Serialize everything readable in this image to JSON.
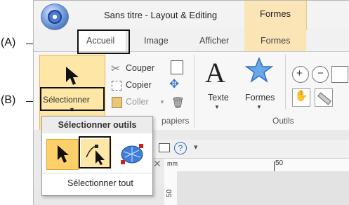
{
  "callouts": {
    "a": "(A)",
    "b": "(B)"
  },
  "window": {
    "title": "Sans titre - Layout & Editing",
    "context_tab": "Formes"
  },
  "tabs": [
    "Accueil",
    "Image",
    "Afficher",
    "Formes"
  ],
  "ribbon": {
    "select_button": "Sélectionner",
    "cut": "Couper",
    "copy": "Copier",
    "paste": "Coller",
    "clipboard_group_partial": "papiers",
    "text_button": "Texte",
    "shapes_button": "Formes",
    "tools_group": "Outils"
  },
  "dropdown": {
    "header": "Sélectionner outils",
    "select_all": "Sélectionner tout",
    "tools": [
      "select-arrow-icon",
      "select-point-icon",
      "select-lasso-icon"
    ]
  },
  "ruler": {
    "mark_50": "50",
    "unit": "mm",
    "vertical_mark": "50"
  },
  "quick_access": {
    "help": "?",
    "more": "▾"
  },
  "colors": {
    "accent": "#fde6a6",
    "accent_border": "#e7b857",
    "context_tab": "#fbe5b7"
  }
}
